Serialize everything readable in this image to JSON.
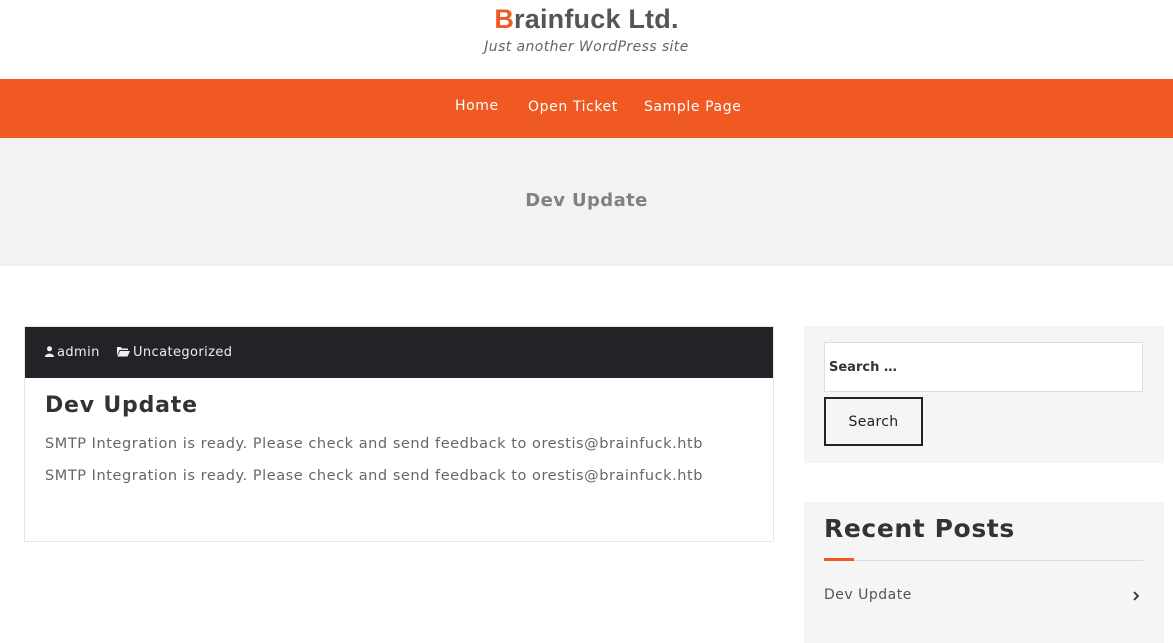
{
  "header": {
    "title_first": "B",
    "title_rest": "rainfuck Ltd.",
    "tagline": "Just another WordPress site"
  },
  "nav": {
    "items": [
      {
        "label": "Home"
      },
      {
        "label": "Open Ticket"
      },
      {
        "label": "Sample Page"
      }
    ]
  },
  "banner": {
    "title": "Dev Update"
  },
  "post": {
    "author": "admin",
    "category": "Uncategorized",
    "title": "Dev Update",
    "body_lines": [
      "SMTP Integration is ready. Please check and send feedback to orestis@brainfuck.htb",
      "SMTP Integration is ready. Please check and send feedback to orestis@brainfuck.htb"
    ]
  },
  "sidebar": {
    "search": {
      "placeholder": "Search …",
      "button_label": "Search"
    },
    "recent_posts": {
      "title": "Recent Posts",
      "items": [
        {
          "label": "Dev Update"
        }
      ]
    }
  },
  "colors": {
    "accent": "#f05a22",
    "meta_bar": "#222326",
    "banner_bg": "#f2f2f2",
    "widget_bg": "#f5f5f5"
  },
  "icons": {
    "author": "user-icon",
    "category": "folder-open-icon",
    "recent_item": "chevron-right-icon"
  }
}
